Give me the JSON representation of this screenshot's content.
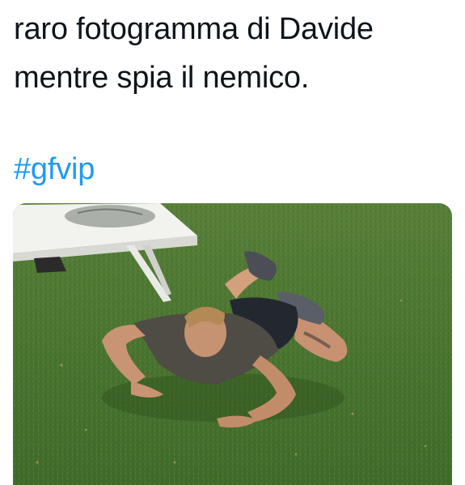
{
  "tweet": {
    "text_line_1": "raro fotogramma di Davide",
    "text_line_2": "mentre spia il nemico.",
    "hashtag": "#gfvip"
  },
  "media": {
    "description": "photo-attachment",
    "accent_colors": {
      "grass": "#4b7a33",
      "link": "#1d9bf0",
      "text": "#0f1419"
    }
  }
}
